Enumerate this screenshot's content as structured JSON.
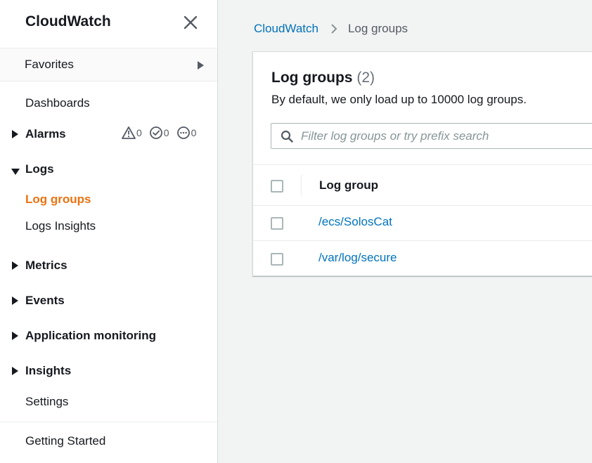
{
  "sidebar": {
    "title": "CloudWatch",
    "favorites_label": "Favorites",
    "items": {
      "dashboards": "Dashboards",
      "alarms": "Alarms",
      "logs": "Logs",
      "log_groups": "Log groups",
      "logs_insights": "Logs Insights",
      "metrics": "Metrics",
      "events": "Events",
      "application_monitoring": "Application monitoring",
      "insights": "Insights",
      "settings": "Settings",
      "getting_started": "Getting Started"
    },
    "alarm_counts": {
      "in_alarm": "0",
      "ok": "0",
      "insufficient_data": "0"
    },
    "active_color": "#ec7211"
  },
  "breadcrumb": {
    "root": "CloudWatch",
    "current": "Log groups"
  },
  "panel": {
    "title": "Log groups",
    "count": "(2)",
    "description": "By default, we only load up to 10000 log groups.",
    "search_placeholder": "Filter log groups or try prefix search",
    "column_header": "Log group",
    "rows": [
      {
        "name": "/ecs/SolosCat"
      },
      {
        "name": "/var/log/secure"
      }
    ]
  },
  "colors": {
    "link": "#0073bb",
    "background": "#f2f3f3"
  }
}
